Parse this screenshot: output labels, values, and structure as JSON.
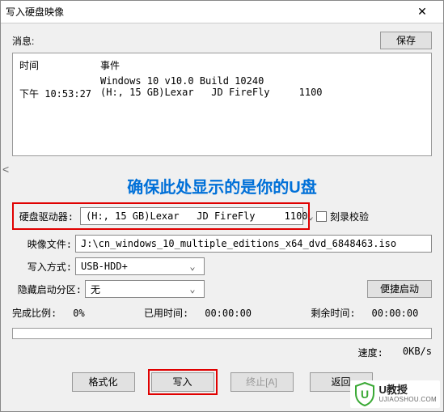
{
  "window": {
    "title": "写入硬盘映像",
    "close": "✕"
  },
  "info": {
    "label": "消息:",
    "save_btn": "保存"
  },
  "log": {
    "time_header": "时间",
    "event_header": "事件",
    "rows": [
      {
        "time": "",
        "event": "Windows 10 v10.0 Build 10240"
      },
      {
        "time": "下午 10:53:27",
        "event": "(H:, 15 GB)Lexar   JD FireFly     1100"
      }
    ],
    "scroll_hint": "<"
  },
  "annotation": "确保此处显示的是你的U盘",
  "drive": {
    "label": "硬盘驱动器:",
    "value": "(H:, 15 GB)Lexar   JD FireFly     1100",
    "checkbox_label": "刻录校验"
  },
  "image_file": {
    "label": "映像文件:",
    "value": "J:\\cn_windows_10_multiple_editions_x64_dvd_6848463.iso"
  },
  "write_mode": {
    "label": "写入方式:",
    "value": "USB-HDD+"
  },
  "hidden_part": {
    "label": "隐藏启动分区:",
    "value": "无",
    "btn": "便捷启动"
  },
  "progress": {
    "complete_label": "完成比例:",
    "complete_value": "0%",
    "elapsed_label": "已用时间:",
    "elapsed_value": "00:00:00",
    "remain_label": "剩余时间:",
    "remain_value": "00:00:00"
  },
  "speed": {
    "label": "速度:",
    "value": "0KB/s"
  },
  "buttons": {
    "format": "格式化",
    "write": "写入",
    "abort": "终止[A]",
    "back": "返回"
  },
  "watermark": {
    "cn": "U教授",
    "en": "UJIAOSHOU.COM"
  },
  "colors": {
    "annotation_red": "#e00000",
    "annotation_blue": "#0070d8",
    "shield_green": "#3aa935"
  }
}
